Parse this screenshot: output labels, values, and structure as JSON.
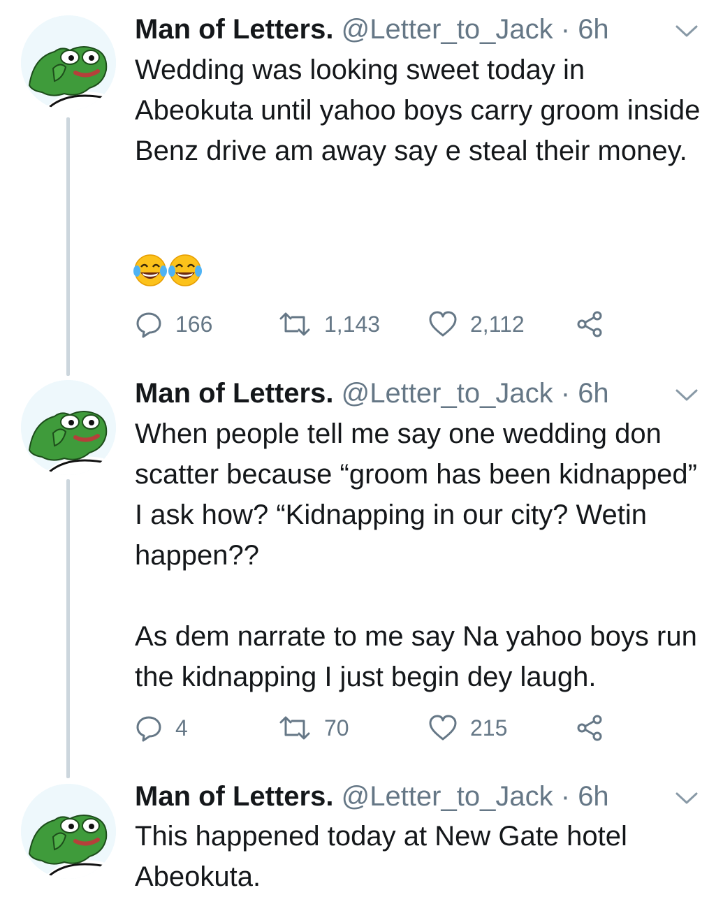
{
  "tweets": [
    {
      "name": "Man of Letters.",
      "handle": "@Letter_to_Jack",
      "separator": "·",
      "time": "6h",
      "text": "Wedding was looking sweet today in Abeokuta until yahoo boys carry groom inside Benz drive am away say e steal their money.",
      "emojis": [
        "😂",
        "😂"
      ],
      "replies": "166",
      "retweets": "1,143",
      "likes": "2,112"
    },
    {
      "name": "Man of Letters.",
      "handle": "@Letter_to_Jack",
      "separator": "·",
      "time": "6h",
      "text": "When people tell me say one wedding don scatter because “groom has been kidnapped” I ask how? “Kidnapping in our city? Wetin happen??\n\nAs dem narrate to me say Na yahoo boys run the kidnapping I just begin dey laugh.",
      "replies": "4",
      "retweets": "70",
      "likes": "215"
    },
    {
      "name": "Man of Letters.",
      "handle": "@Letter_to_Jack",
      "separator": "·",
      "time": "6h",
      "text": "This happened today at New Gate hotel Abeokuta."
    }
  ],
  "colors": {
    "primary_text": "#14171a",
    "secondary_text": "#657786",
    "thread_line": "#ccd6dd",
    "avatar_frog": "#3f9b3b"
  },
  "icons": {
    "avatar": "pepe-frog-avatar",
    "menu": "chevron-down-icon",
    "reply": "reply-icon",
    "retweet": "retweet-icon",
    "like": "heart-icon",
    "share": "share-icon"
  }
}
